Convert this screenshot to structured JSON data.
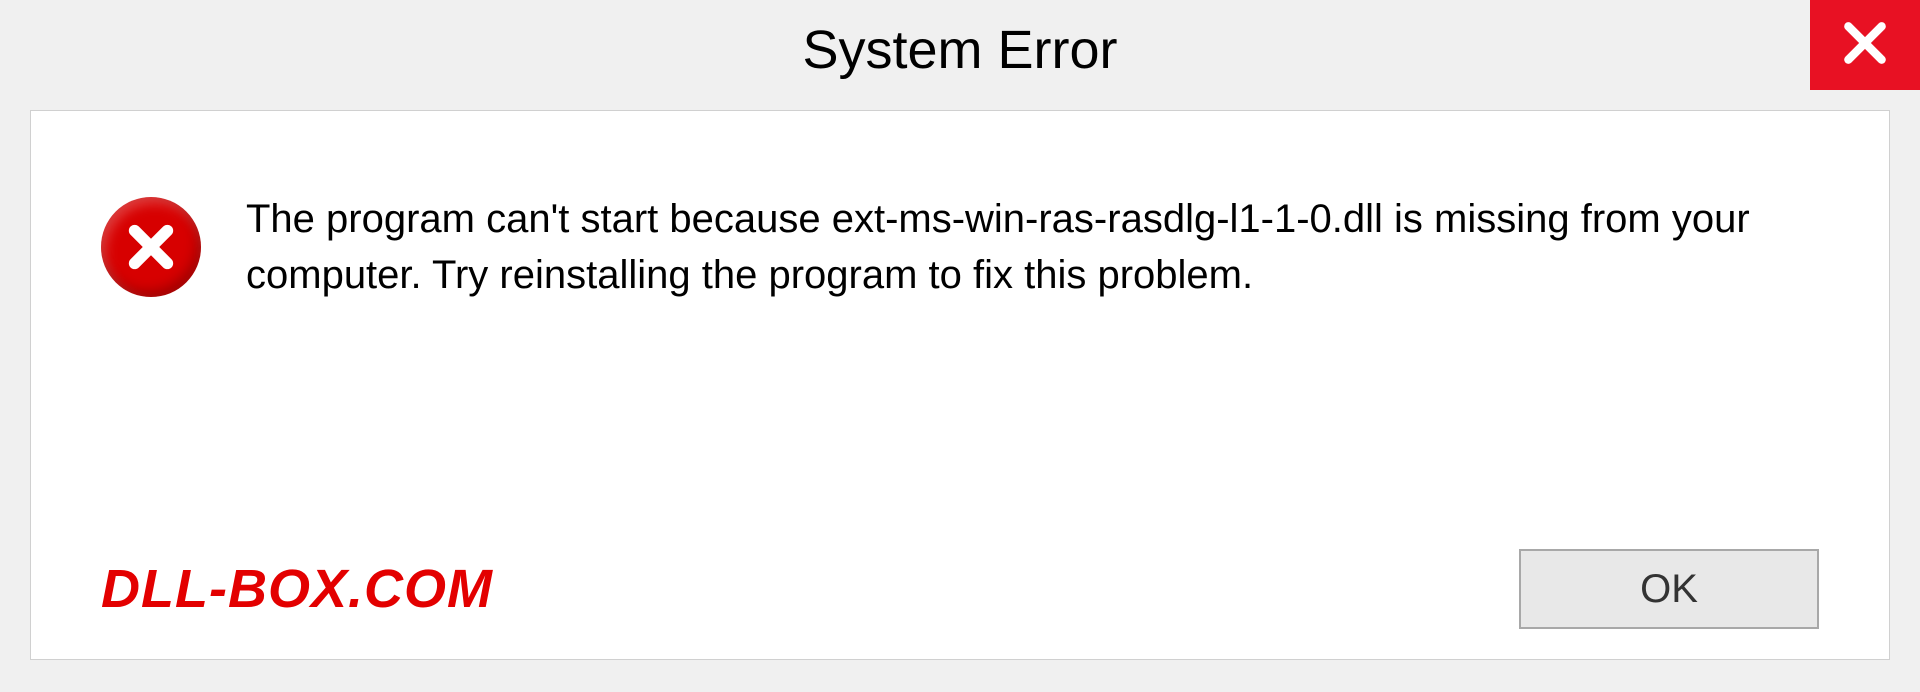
{
  "dialog": {
    "title": "System Error",
    "message": "The program can't start because ext-ms-win-ras-rasdlg-l1-1-0.dll is missing from your computer. Try reinstalling the program to fix this problem.",
    "ok_label": "OK",
    "watermark": "DLL-BOX.COM",
    "close_icon": "close-icon",
    "error_icon": "error-circle-x-icon",
    "colors": {
      "close_bg": "#e81123",
      "error_bg": "#d70000",
      "watermark_fg": "#e30000"
    }
  }
}
